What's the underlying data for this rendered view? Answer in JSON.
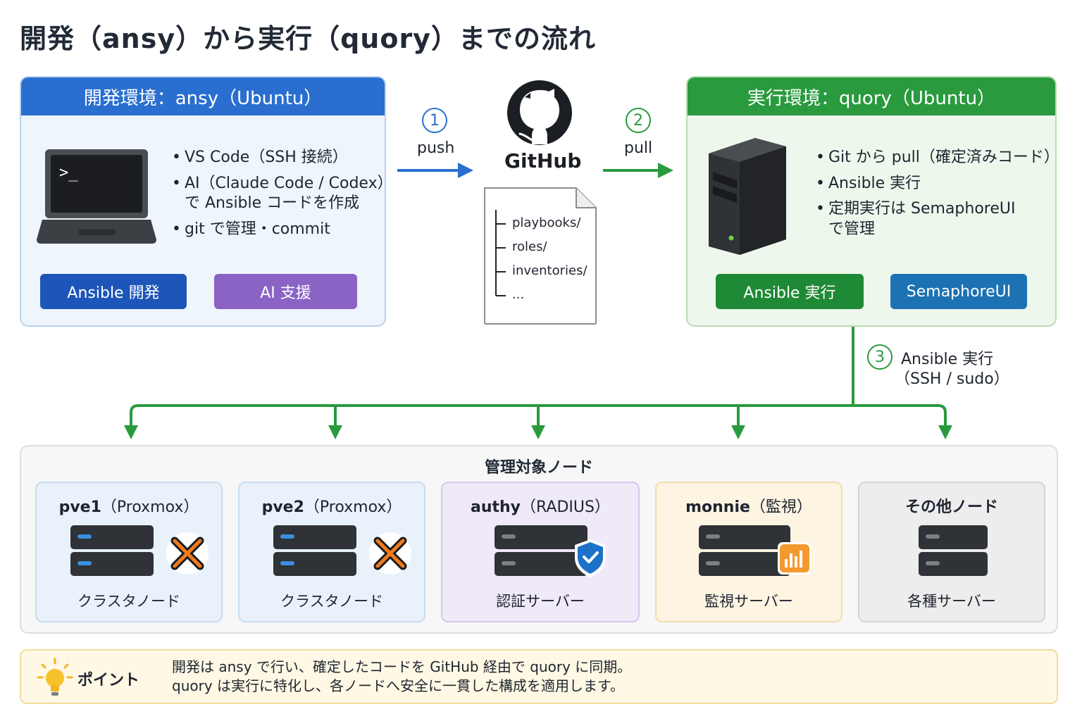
{
  "title": "開発（ansy）から実行（quory）までの流れ",
  "dev": {
    "header": "開発環境：ansy（Ubuntu）",
    "bullets": [
      {
        "line1": "VS Code（SSH 接続）"
      },
      {
        "line1": "AI（Claude Code / Codex）",
        "line2": "で Ansible コードを作成"
      },
      {
        "line1": "git で管理・commit"
      }
    ],
    "badges": [
      {
        "label": "Ansible 開発",
        "color": "#1d56b8"
      },
      {
        "label": "AI 支援",
        "color": "#8a63c5"
      }
    ]
  },
  "run": {
    "header": "実行環境：quory（Ubuntu）",
    "bullets": [
      {
        "line1": "Git から pull（確定済みコード）"
      },
      {
        "line1": "Ansible 実行"
      },
      {
        "line1": "定期実行は SemaphoreUI",
        "line2": "で管理"
      }
    ],
    "badges": [
      {
        "label": "Ansible 実行",
        "color": "#1f8a35"
      },
      {
        "label": "SemaphoreUI",
        "color": "#1c72b3"
      }
    ]
  },
  "flow": {
    "step1": {
      "num": "1",
      "label": "push"
    },
    "step2": {
      "num": "2",
      "label": "pull"
    },
    "step3": {
      "num": "3",
      "label1": "Ansible 実行",
      "label2": "（SSH / sudo）"
    }
  },
  "github": {
    "name": "GitHub",
    "repo_items": [
      "playbooks/",
      "roles/",
      "inventories/",
      "..."
    ]
  },
  "nodes": {
    "title": "管理対象ノード",
    "items": [
      {
        "name": "pve1",
        "sub": "（Proxmox）",
        "desc": "クラスタノード",
        "icon": "proxmox-icon"
      },
      {
        "name": "pve2",
        "sub": "（Proxmox）",
        "desc": "クラスタノード",
        "icon": "proxmox-icon"
      },
      {
        "name": "authy",
        "sub": "（RADIUS）",
        "desc": "認証サーバー",
        "icon": "shield-icon"
      },
      {
        "name": "monnie",
        "sub": "（監視）",
        "desc": "監視サーバー",
        "icon": "chart-icon"
      },
      {
        "name": "その他ノード",
        "sub": "",
        "desc": "各種サーバー",
        "icon": ""
      }
    ]
  },
  "point": {
    "label": "ポイント",
    "line1": "開発は ansy で行い、確定したコードを GitHub 経由で quory に同期。",
    "line2": "quory は実行に特化し、各ノードへ安全に一貫した構成を適用します。"
  },
  "colors": {
    "blue": "#2a6fd0",
    "green": "#2a9a3e",
    "orange": "#f29a2e"
  }
}
